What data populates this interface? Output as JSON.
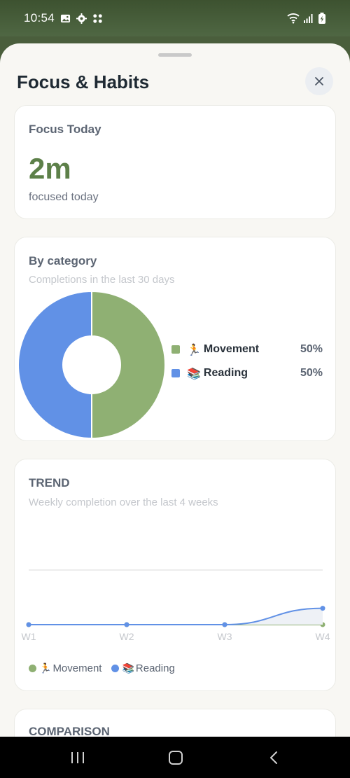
{
  "status_bar": {
    "time": "10:54"
  },
  "sheet": {
    "title": "Focus & Habits"
  },
  "focus_card": {
    "title": "Focus Today",
    "value": "2m",
    "label": "focused today"
  },
  "category_card": {
    "title": "By category",
    "subtitle": "Completions in the last 30 days",
    "legend": [
      {
        "emoji": "🏃",
        "name": "Movement",
        "percent": "50%",
        "color": "#8fb073"
      },
      {
        "emoji": "📚",
        "name": "Reading",
        "percent": "50%",
        "color": "#6191e6"
      }
    ]
  },
  "trend_card": {
    "title": "TREND",
    "subtitle": "Weekly completion over the last 4 weeks",
    "legend": [
      {
        "emoji": "🏃",
        "name": "Movement",
        "color": "#8fb073"
      },
      {
        "emoji": "📚",
        "name": "Reading",
        "color": "#6191e6"
      }
    ]
  },
  "comparison_card": {
    "title": "COMPARISON"
  },
  "chart_data": [
    {
      "type": "pie",
      "title": "By category",
      "subtitle": "Completions in the last 30 days",
      "categories": [
        "🏃 Movement",
        "📚 Reading"
      ],
      "values": [
        50,
        50
      ],
      "colors": [
        "#8fb073",
        "#6191e6"
      ],
      "donut": true
    },
    {
      "type": "line",
      "title": "TREND",
      "subtitle": "Weekly completion over the last 4 weeks",
      "x": [
        "W1",
        "W2",
        "W3",
        "W4"
      ],
      "series": [
        {
          "name": "🏃 Movement",
          "values": [
            0,
            0,
            0,
            0
          ],
          "color": "#8fb073"
        },
        {
          "name": "📚 Reading",
          "values": [
            0,
            0,
            0,
            0.3
          ],
          "color": "#6191e6"
        }
      ],
      "ylim": [
        0,
        1
      ],
      "grid": true,
      "legend": "bottom"
    }
  ],
  "nav": {
    "recents": "recents",
    "home": "home",
    "back": "back"
  }
}
